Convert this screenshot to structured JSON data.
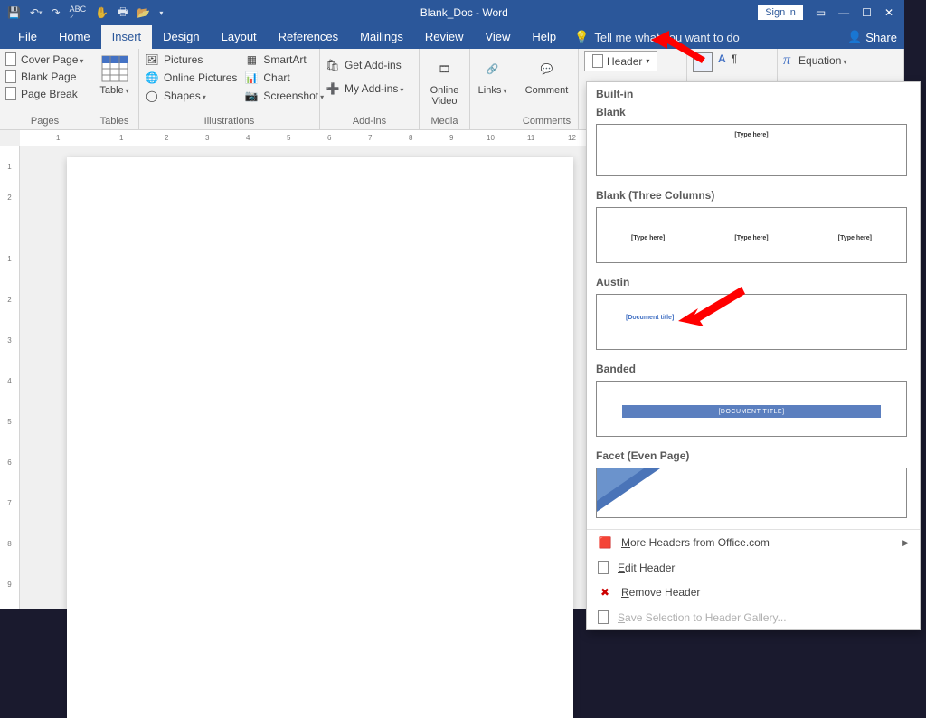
{
  "titlebar": {
    "title": "Blank_Doc - Word",
    "signin": "Sign in"
  },
  "tabs": {
    "file": "File",
    "home": "Home",
    "insert": "Insert",
    "design": "Design",
    "layout": "Layout",
    "references": "References",
    "mailings": "Mailings",
    "review": "Review",
    "view": "View",
    "help": "Help",
    "tellme": "Tell me what you want to do",
    "share": "Share"
  },
  "ribbon": {
    "pages": {
      "cover": "Cover Page",
      "blank": "Blank Page",
      "break": "Page Break",
      "label": "Pages"
    },
    "tables": {
      "table": "Table",
      "label": "Tables"
    },
    "illus": {
      "pictures": "Pictures",
      "online": "Online Pictures",
      "shapes": "Shapes",
      "smartart": "SmartArt",
      "chart": "Chart",
      "screenshot": "Screenshot",
      "label": "Illustrations"
    },
    "addins": {
      "get": "Get Add-ins",
      "my": "My Add-ins",
      "label": "Add-ins"
    },
    "media": {
      "video": "Online\nVideo",
      "label": "Media"
    },
    "links": {
      "links": "Links",
      "label": ""
    },
    "comments": {
      "comment": "Comment",
      "label": "Comments"
    },
    "hf": {
      "header": "Header"
    },
    "text": {},
    "symbols": {
      "equation": "Equation"
    }
  },
  "ruler": {
    "h": [
      "1",
      "1",
      "2",
      "3",
      "4",
      "5",
      "6",
      "7",
      "8",
      "9",
      "10",
      "11",
      "12"
    ],
    "v": [
      "1",
      "2",
      "1",
      "2",
      "3",
      "4",
      "5",
      "6",
      "7",
      "8",
      "9"
    ]
  },
  "headerGallery": {
    "section": "Built-in",
    "items": [
      {
        "name": "Blank",
        "placeholder": "[Type here]"
      },
      {
        "name": "Blank (Three Columns)",
        "placeholder": "[Type here]"
      },
      {
        "name": "Austin",
        "placeholder": "[Document title]"
      },
      {
        "name": "Banded",
        "placeholder": "[DOCUMENT TITLE]"
      },
      {
        "name": "Facet (Even Page)",
        "placeholder": ""
      }
    ],
    "more": "More Headers from Office.com",
    "edit": "Edit Header",
    "remove": "Remove Header",
    "save": "Save Selection to Header Gallery..."
  }
}
